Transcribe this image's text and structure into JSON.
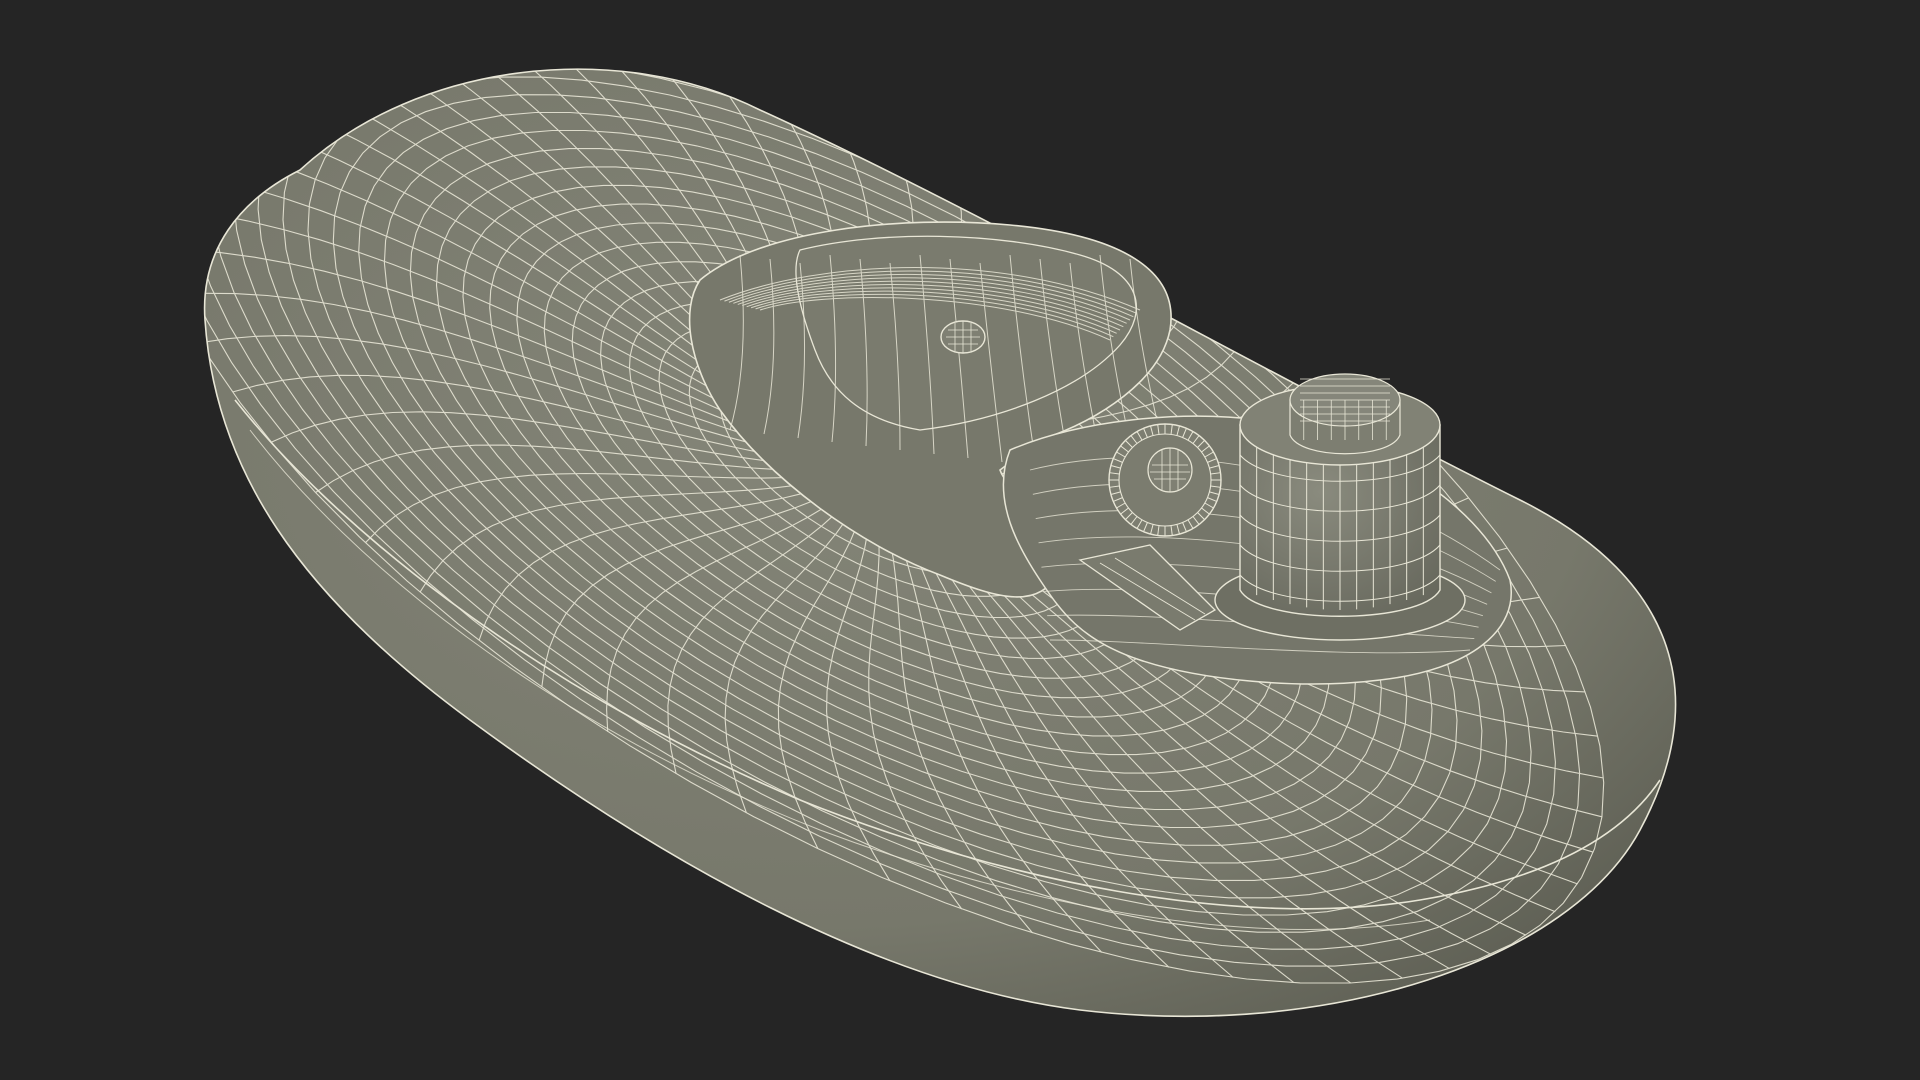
{
  "scene": {
    "subject": "wireframe-3d-model-oval-device",
    "colors": {
      "background": "#252525",
      "surface": "#7b7c6f",
      "surface_shade": "#5f6055",
      "wire": "#e8e6d6"
    }
  }
}
